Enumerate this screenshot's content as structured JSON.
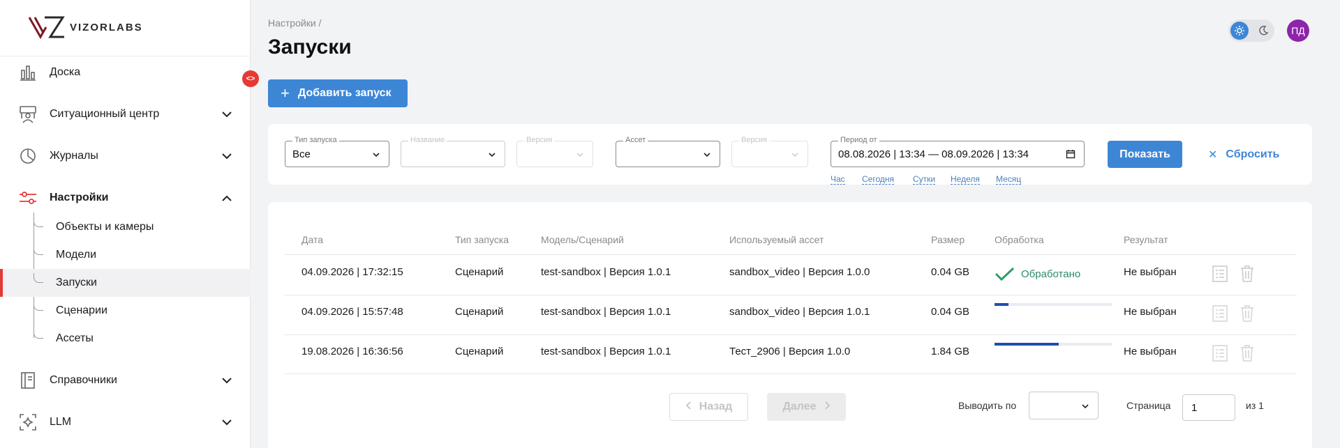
{
  "brand": {
    "logo_text": "VIZORLABS"
  },
  "sidebar": {
    "items": [
      {
        "label": "Доска",
        "icon": "chart-bars-icon"
      },
      {
        "label": "Ситуационный центр",
        "icon": "monitoring-center-icon"
      },
      {
        "label": "Журналы",
        "icon": "pie-chart-icon"
      },
      {
        "label": "Настройки",
        "icon": "sliders-icon",
        "expanded": true
      },
      {
        "label": "Справочники",
        "icon": "book-icon"
      },
      {
        "label": "LLM",
        "icon": "llm-icon"
      }
    ],
    "sub_items": [
      {
        "label": "Объекты и камеры"
      },
      {
        "label": "Модели"
      },
      {
        "label": "Запуски",
        "active": true
      },
      {
        "label": "Сценарии"
      },
      {
        "label": "Ассеты"
      }
    ],
    "collapse_glyph": "<>"
  },
  "header": {
    "breadcrumb": "Настройки /",
    "title": "Запуски",
    "avatar_initials": "ПД"
  },
  "toolbar": {
    "add_label": "Добавить запуск"
  },
  "filters": {
    "type": {
      "legend": "Тип запуска",
      "value": "Все"
    },
    "name": {
      "legend": "Название",
      "value": ""
    },
    "version1": {
      "legend": "Версия",
      "value": ""
    },
    "asset": {
      "legend": "Ассет",
      "value": ""
    },
    "version2": {
      "legend": "Версия",
      "value": ""
    },
    "period": {
      "legend": "Период от",
      "value": "08.08.2026 | 13:34 — 08.09.2026 | 13:34"
    },
    "quick": [
      "Час",
      "Сегодня",
      "Сутки",
      "Неделя",
      "Месяц"
    ],
    "show_label": "Показать",
    "reset_label": "Сбросить"
  },
  "table": {
    "headers": [
      "Дата",
      "Тип запуска",
      "Модель/Сценарий",
      "Используемый ассет",
      "Размер",
      "Обработка",
      "Результат"
    ],
    "rows": [
      {
        "date": "04.09.2026 | 17:32:15",
        "type": "Сценарий",
        "model": "test-sandbox | Версия 1.0.1",
        "asset": "sandbox_video | Версия 1.0.0",
        "size": "0.04 GB",
        "status": "Обработано",
        "progress": 1.0,
        "result": "Не выбран"
      },
      {
        "date": "04.09.2026 | 15:57:48",
        "type": "Сценарий",
        "model": "test-sandbox | Версия 1.0.1",
        "asset": "sandbox_video | Версия 1.0.1",
        "size": "0.04 GB",
        "status": "",
        "progress": 0.12,
        "result": "Не выбран"
      },
      {
        "date": "19.08.2026 | 16:36:56",
        "type": "Сценарий",
        "model": "test-sandbox | Версия 1.0.1",
        "asset": "Тест_2906 | Версия 1.0.0",
        "size": "1.84 GB",
        "status": "",
        "progress": 0.55,
        "result": "Не выбран"
      }
    ]
  },
  "pagination": {
    "prev_label": "Назад",
    "next_label": "Далее",
    "per_page_label": "Выводить по",
    "per_page_value": "",
    "page_label": "Страница",
    "page_value": "1",
    "total_label": "из 1"
  },
  "colors": {
    "accent": "#3d86d6",
    "brand_red": "#e53935",
    "avatar": "#8e24aa",
    "success": "#2e8b6b",
    "progress": "#1e4fb0"
  }
}
